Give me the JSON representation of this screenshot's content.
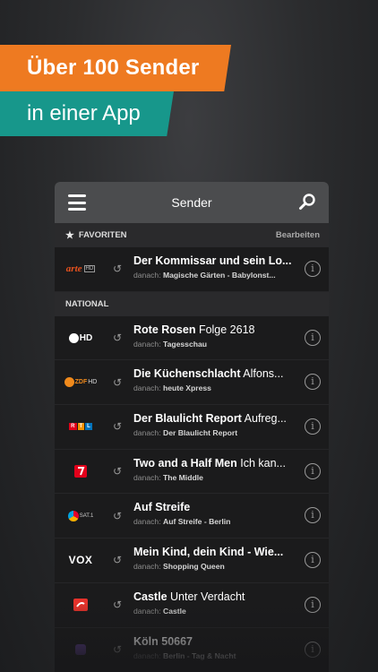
{
  "promo": {
    "headline": "Über 100 Sender",
    "subline": "in einer App"
  },
  "navbar": {
    "title": "Sender"
  },
  "favorites": {
    "header": "FAVORITEN",
    "edit_label": "Bearbeiten",
    "items": [
      {
        "channel": "arte HD",
        "title": "Der Kommissar und sein Lo...",
        "episode": "",
        "next_label": "danach:",
        "next": "Magische Gärten - Babylonst..."
      }
    ]
  },
  "national": {
    "header": "NATIONAL",
    "items": [
      {
        "channel": "Das Erste HD",
        "title": "Rote Rosen",
        "episode": "Folge 2618",
        "next_label": "danach:",
        "next": "Tagesschau"
      },
      {
        "channel": "ZDF HD",
        "title": "Die Küchenschlacht",
        "episode": "Alfons...",
        "next_label": "danach:",
        "next": "heute Xpress"
      },
      {
        "channel": "RTL",
        "title": "Der Blaulicht Report",
        "episode": "Aufreg...",
        "next_label": "danach:",
        "next": "Der Blaulicht Report"
      },
      {
        "channel": "ProSieben",
        "title": "Two and a Half Men",
        "episode": "Ich kan...",
        "next_label": "danach:",
        "next": "The Middle"
      },
      {
        "channel": "SAT.1",
        "title": "Auf Streife",
        "episode": "",
        "next_label": "danach:",
        "next": "Auf Streife - Berlin"
      },
      {
        "channel": "VOX",
        "title": "Mein Kind, dein Kind - Wie...",
        "episode": "",
        "next_label": "danach:",
        "next": "Shopping Queen"
      },
      {
        "channel": "kabel eins",
        "title": "Castle",
        "episode": "Unter Verdacht",
        "next_label": "danach:",
        "next": "Castle"
      },
      {
        "channel": "RTL II",
        "title": "Köln 50667",
        "episode": "",
        "next_label": "danach:",
        "next": "Berlin - Tag & Nacht"
      }
    ]
  },
  "logo_text": {
    "arte": "arte",
    "arte_hd": "HD",
    "ard_hd": "HD",
    "zdf": "ZDF",
    "zdf_hd": "HD",
    "rtl": [
      "R",
      "T",
      "L"
    ],
    "sat1": "SAT.1",
    "vox": "VOX"
  },
  "colors": {
    "orange": "#ee7a21",
    "teal": "#17978b",
    "navbar": "#4b4c4e"
  }
}
